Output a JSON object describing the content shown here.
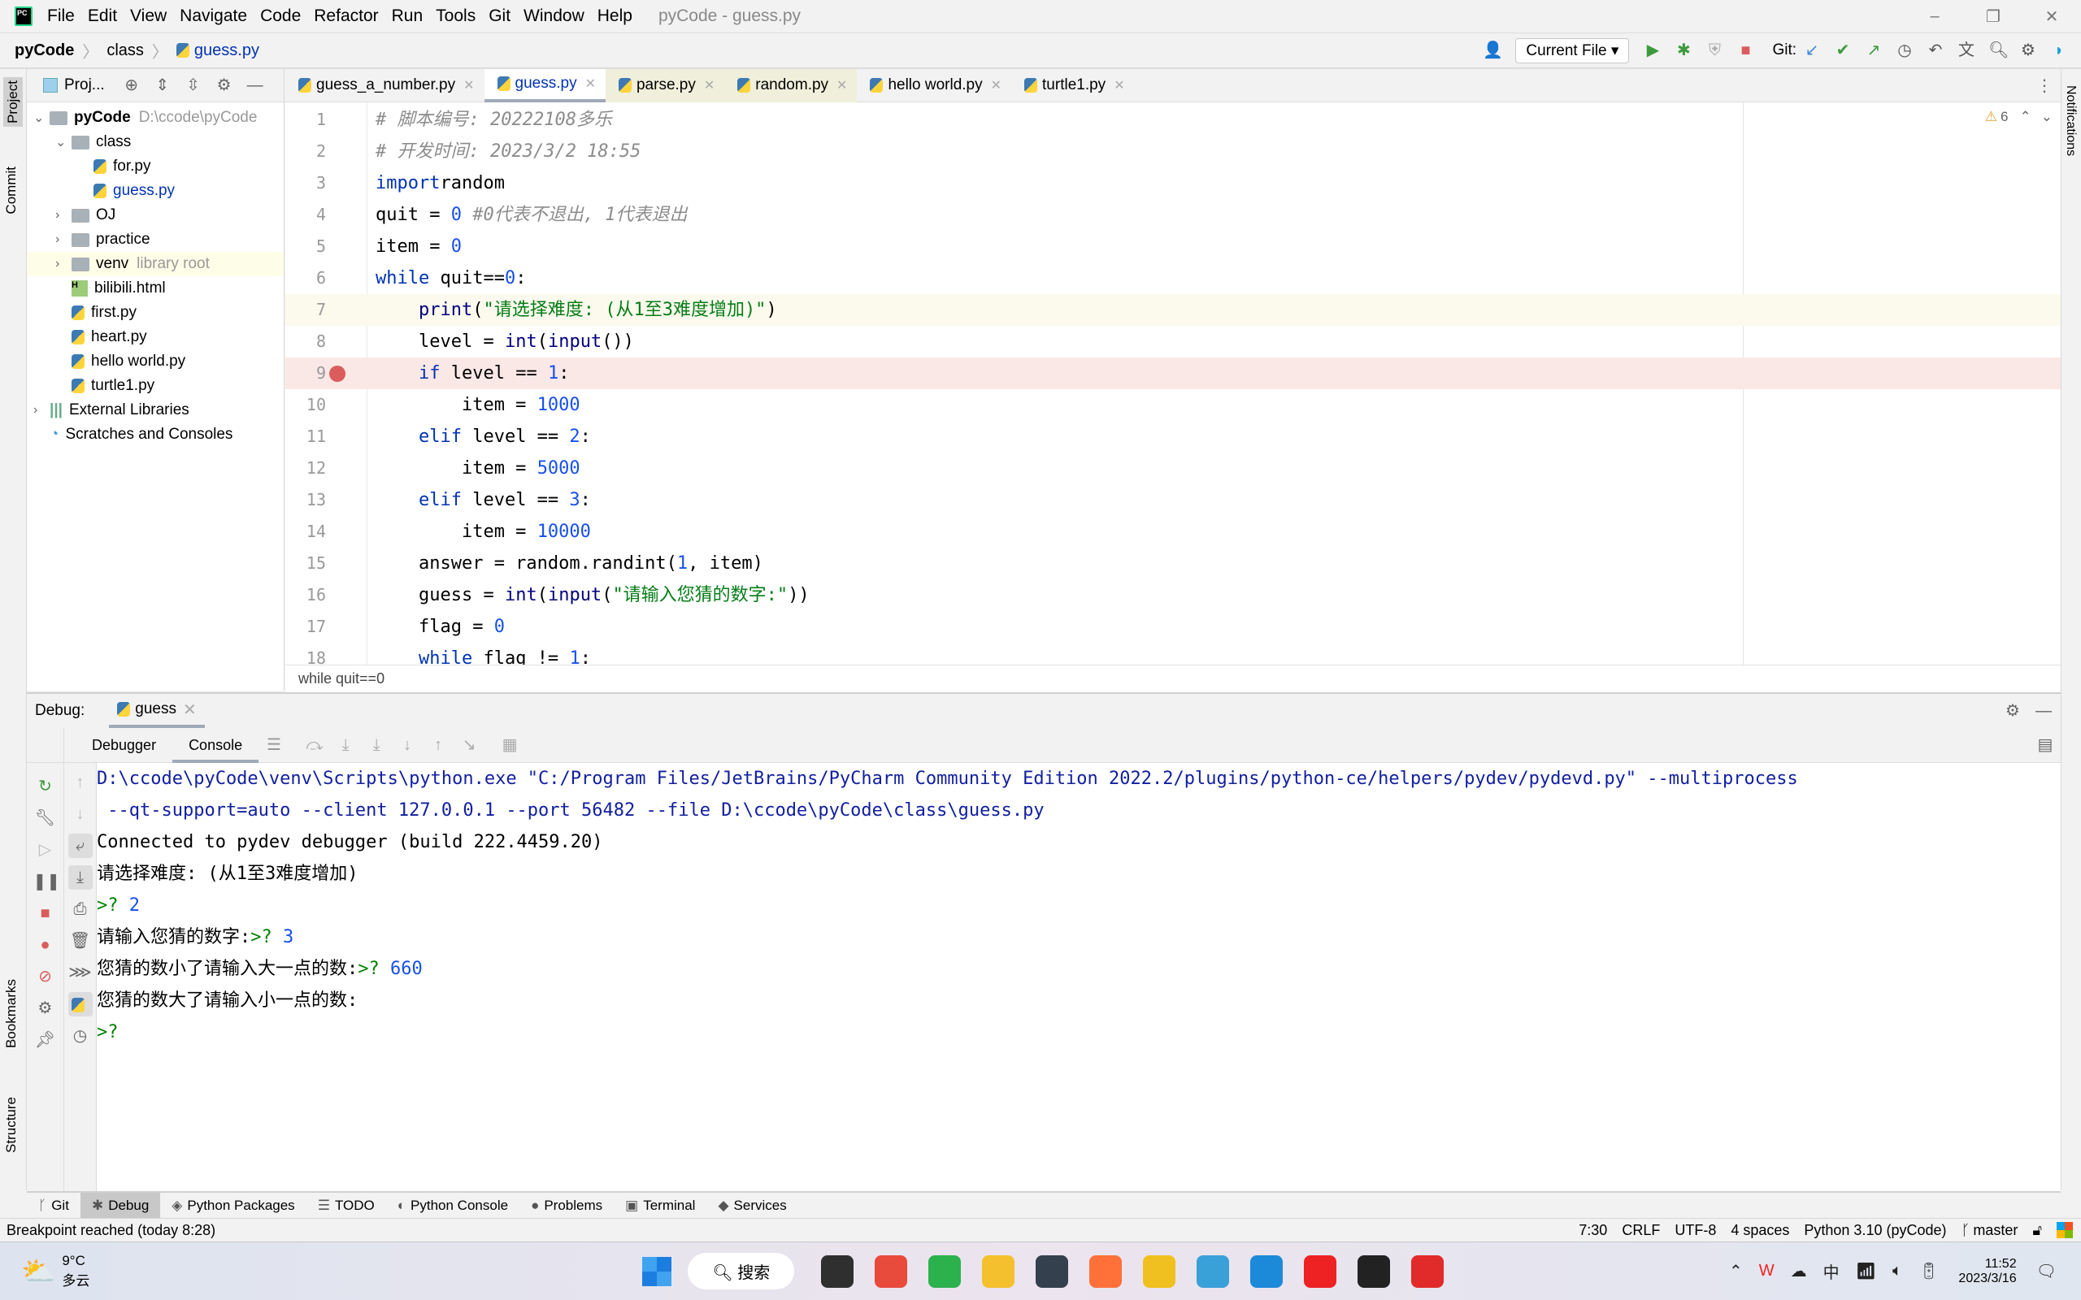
{
  "window": {
    "title": "pyCode - guess.py",
    "menu": [
      "File",
      "Edit",
      "View",
      "Navigate",
      "Code",
      "Refactor",
      "Run",
      "Tools",
      "Git",
      "Window",
      "Help"
    ],
    "controls": [
      "–",
      "❐",
      "✕"
    ]
  },
  "breadcrumb": [
    "pyCode",
    "class",
    "guess.py"
  ],
  "toolbar": {
    "run_config": "Current File",
    "git_label": "Git:"
  },
  "left_strip": [
    "Project",
    "Commit",
    "Bookmarks",
    "Structure"
  ],
  "right_strip": [
    "Notifications"
  ],
  "project": {
    "header": "Proj...",
    "tree": [
      {
        "label": "pyCode",
        "extra": "D:\\ccode\\pyCode",
        "type": "folder",
        "depth": 0,
        "open": true,
        "bold": true
      },
      {
        "label": "class",
        "type": "folder",
        "depth": 1,
        "open": true
      },
      {
        "label": "for.py",
        "type": "py",
        "depth": 2
      },
      {
        "label": "guess.py",
        "type": "py",
        "depth": 2,
        "active": true
      },
      {
        "label": "OJ",
        "type": "folder",
        "depth": 1,
        "open": false
      },
      {
        "label": "practice",
        "type": "folder",
        "depth": 1,
        "open": false
      },
      {
        "label": "venv",
        "extra": "library root",
        "type": "folder",
        "depth": 1,
        "open": false,
        "highlight": true
      },
      {
        "label": "bilibili.html",
        "type": "html",
        "depth": 1
      },
      {
        "label": "first.py",
        "type": "py",
        "depth": 1
      },
      {
        "label": "heart.py",
        "type": "py",
        "depth": 1
      },
      {
        "label": "hello world.py",
        "type": "py",
        "depth": 1
      },
      {
        "label": "turtle1.py",
        "type": "py",
        "depth": 1
      },
      {
        "label": "External Libraries",
        "type": "lib",
        "depth": 0,
        "open": false
      },
      {
        "label": "Scratches and Consoles",
        "type": "scratch",
        "depth": 0
      }
    ]
  },
  "tabs": [
    {
      "label": "guess_a_number.py"
    },
    {
      "label": "guess.py",
      "active": true
    },
    {
      "label": "parse.py",
      "yellow": true
    },
    {
      "label": "random.py",
      "yellow": true
    },
    {
      "label": "hello world.py"
    },
    {
      "label": "turtle1.py"
    }
  ],
  "editor": {
    "warnings": "6",
    "current_line": 7,
    "breakpoint_line": 9,
    "lines": [
      [
        [
          "cm",
          "# 脚本编号: 20222108多乐"
        ]
      ],
      [
        [
          "cm",
          "# 开发时间: 2023/3/2 18:55"
        ]
      ],
      [
        [
          "kw",
          "import"
        ],
        [
          "",
          "random"
        ]
      ],
      [
        [
          "",
          "quit = "
        ],
        [
          "nm",
          "0"
        ],
        [
          "cm",
          " #0代表不退出, 1代表退出"
        ]
      ],
      [
        [
          "",
          "item = "
        ],
        [
          "nm",
          "0"
        ]
      ],
      [
        [
          "kw",
          "while"
        ],
        [
          "",
          " quit=="
        ],
        [
          "nm",
          "0"
        ],
        [
          "",
          ":"
        ]
      ],
      [
        [
          "",
          "    "
        ],
        [
          "bi",
          "print"
        ],
        [
          "",
          "("
        ],
        [
          "st",
          "\"请选择难度: (从1至3难度增加)\""
        ],
        [
          "",
          ")"
        ]
      ],
      [
        [
          "",
          "    level = "
        ],
        [
          "bi",
          "int"
        ],
        [
          "",
          "("
        ],
        [
          "bi",
          "input"
        ],
        [
          "",
          "())"
        ]
      ],
      [
        [
          "",
          "    "
        ],
        [
          "kw",
          "if"
        ],
        [
          "",
          " level == "
        ],
        [
          "nm",
          "1"
        ],
        [
          "",
          ":"
        ]
      ],
      [
        [
          "",
          "        item = "
        ],
        [
          "nm",
          "1000"
        ]
      ],
      [
        [
          "",
          "    "
        ],
        [
          "kw",
          "elif"
        ],
        [
          "",
          " level == "
        ],
        [
          "nm",
          "2"
        ],
        [
          "",
          ":"
        ]
      ],
      [
        [
          "",
          "        item = "
        ],
        [
          "nm",
          "5000"
        ]
      ],
      [
        [
          "",
          "    "
        ],
        [
          "kw",
          "elif"
        ],
        [
          "",
          " level == "
        ],
        [
          "nm",
          "3"
        ],
        [
          "",
          ":"
        ]
      ],
      [
        [
          "",
          "        item = "
        ],
        [
          "nm",
          "10000"
        ]
      ],
      [
        [
          "",
          "    answer = random.randint("
        ],
        [
          "nm",
          "1"
        ],
        [
          "",
          ", item)"
        ]
      ],
      [
        [
          "",
          "    guess = "
        ],
        [
          "bi",
          "int"
        ],
        [
          "",
          "("
        ],
        [
          "bi",
          "input"
        ],
        [
          "",
          "("
        ],
        [
          "st",
          "\"请输入您猜的数字:\""
        ],
        [
          "",
          "))"
        ]
      ],
      [
        [
          "",
          "    flag = "
        ],
        [
          "nm",
          "0"
        ]
      ],
      [
        [
          "",
          "    "
        ],
        [
          "kw",
          "while"
        ],
        [
          "",
          " flag != "
        ],
        [
          "nm",
          "1"
        ],
        [
          "",
          ":"
        ]
      ]
    ],
    "breadcrumb": "while quit==0"
  },
  "debug": {
    "label": "Debug:",
    "session": "guess",
    "tabs": [
      "Debugger",
      "Console"
    ],
    "console": [
      [
        [
          "sys",
          "D:\\ccode\\pyCode\\venv\\Scripts\\python.exe \"C:/Program Files/JetBrains/PyCharm Community Edition 2022.2/plugins/python-ce/helpers/pydev/pydevd.py\" --multiprocess"
        ]
      ],
      [
        [
          "sys",
          " --qt-support=auto --client 127.0.0.1 --port 56482 --file D:\\ccode\\pyCode\\class\\guess.py"
        ]
      ],
      [
        [
          "",
          "Connected to pydev debugger (build 222.4459.20)"
        ]
      ],
      [
        [
          "",
          "请选择难度: (从1至3难度增加)"
        ]
      ],
      [
        [
          "inp",
          ">? "
        ],
        [
          "val",
          "2"
        ]
      ],
      [
        [
          "",
          "请输入您猜的数字:"
        ],
        [
          "inp",
          ">? "
        ],
        [
          "val",
          "3"
        ]
      ],
      [
        [
          "",
          "您猜的数小了请输入大一点的数:"
        ],
        [
          "inp",
          ">? "
        ],
        [
          "val",
          "660"
        ]
      ],
      [
        [
          "",
          "您猜的数大了请输入小一点的数:"
        ]
      ],
      [
        [
          "inp",
          ">?"
        ]
      ]
    ]
  },
  "bottom_tabs": [
    {
      "label": "Git",
      "icon": "ᚴ"
    },
    {
      "label": "Debug",
      "icon": "✱",
      "active": true
    },
    {
      "label": "Python Packages",
      "icon": "◈"
    },
    {
      "label": "TODO",
      "icon": "☰"
    },
    {
      "label": "Python Console",
      "icon": "◐"
    },
    {
      "label": "Problems",
      "icon": "●"
    },
    {
      "label": "Terminal",
      "icon": "▣"
    },
    {
      "label": "Services",
      "icon": "◆"
    }
  ],
  "status": {
    "message": "Breakpoint reached (today 8:28)",
    "position": "7:30",
    "line_sep": "CRLF",
    "encoding": "UTF-8",
    "indent": "4 spaces",
    "interpreter": "Python 3.10 (pyCode)",
    "branch": "master"
  },
  "taskbar": {
    "weather_temp": "9°C",
    "weather_desc": "多云",
    "search": "搜索",
    "time": "11:52",
    "date": "2023/3/16",
    "ime": "中",
    "apps": [
      "#2f2f2f",
      "#e84a3c",
      "#2bb24c",
      "#f5c02e",
      "#34404e",
      "#ff7139",
      "#f0c020",
      "#3aa0d8",
      "#1c8ad8",
      "#e22",
      "#222",
      "#e12a2a"
    ]
  },
  "colors": {
    "accent": "#0033b3",
    "breakpoint": "#db5c5c",
    "current_line_bg": "#fcfaed",
    "breakpoint_line_bg": "#fae8e6"
  }
}
